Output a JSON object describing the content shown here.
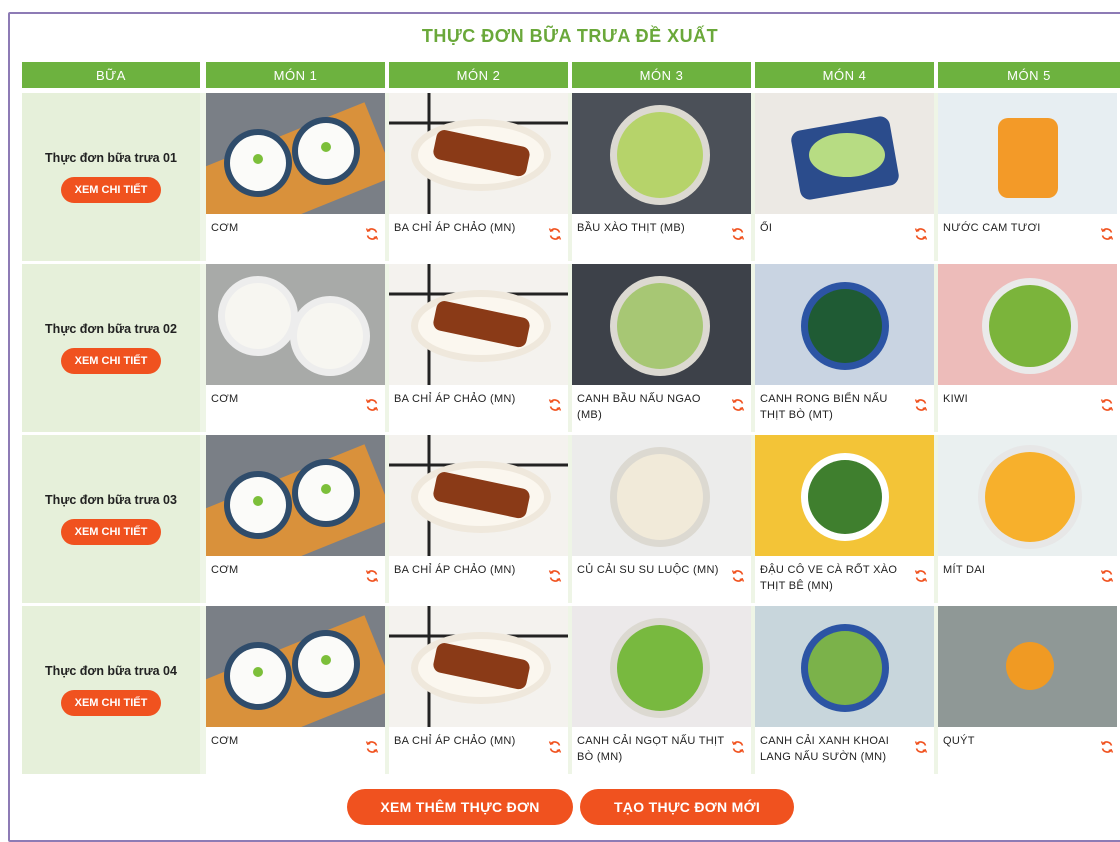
{
  "title": "THỰC ĐƠN BỮA TRƯA ĐỀ XUẤT",
  "headers": [
    "BỮA",
    "MÓN 1",
    "MÓN 2",
    "MÓN 3",
    "MÓN 4",
    "MÓN 5"
  ],
  "detail_label": "XEM CHI TIẾT",
  "colors": {
    "green": "#6db23f",
    "orange": "#f0521f",
    "cell_bg": "#e6f0da"
  },
  "menus": [
    {
      "name": "Thực đơn bữa trưa 01",
      "dishes": [
        "CƠM",
        "BA CHỈ ÁP CHẢO (MN)",
        "BẦU XÀO THỊT (MB)",
        "ỔI",
        "NƯỚC CAM TƯƠI"
      ]
    },
    {
      "name": "Thực đơn bữa trưa 02",
      "dishes": [
        "CƠM",
        "BA CHỈ ÁP CHẢO (MN)",
        "CANH BẦU NẤU NGAO (MB)",
        "CANH RONG BIỂN NẤU THỊT BÒ (MT)",
        "KIWI"
      ]
    },
    {
      "name": "Thực đơn bữa trưa 03",
      "dishes": [
        "CƠM",
        "BA CHỈ ÁP CHẢO (MN)",
        "CỦ CẢI SU SU LUỘC (MN)",
        "ĐẬU CÔ VE CÀ RỐT XÀO THỊT BÊ (MN)",
        "MÍT DAI"
      ]
    },
    {
      "name": "Thực đơn bữa trưa 04",
      "dishes": [
        "CƠM",
        "BA CHỈ ÁP CHẢO (MN)",
        "CANH CẢI NGỌT NẤU THỊT BÒ (MN)",
        "CANH CẢI XANH KHOAI LANG NẤU SƯỜN (MN)",
        "QUÝT"
      ]
    }
  ],
  "buttons": {
    "more": "XEM THÊM THỰC ĐƠN",
    "create": "TẠO THỰC ĐƠN MỚI"
  }
}
